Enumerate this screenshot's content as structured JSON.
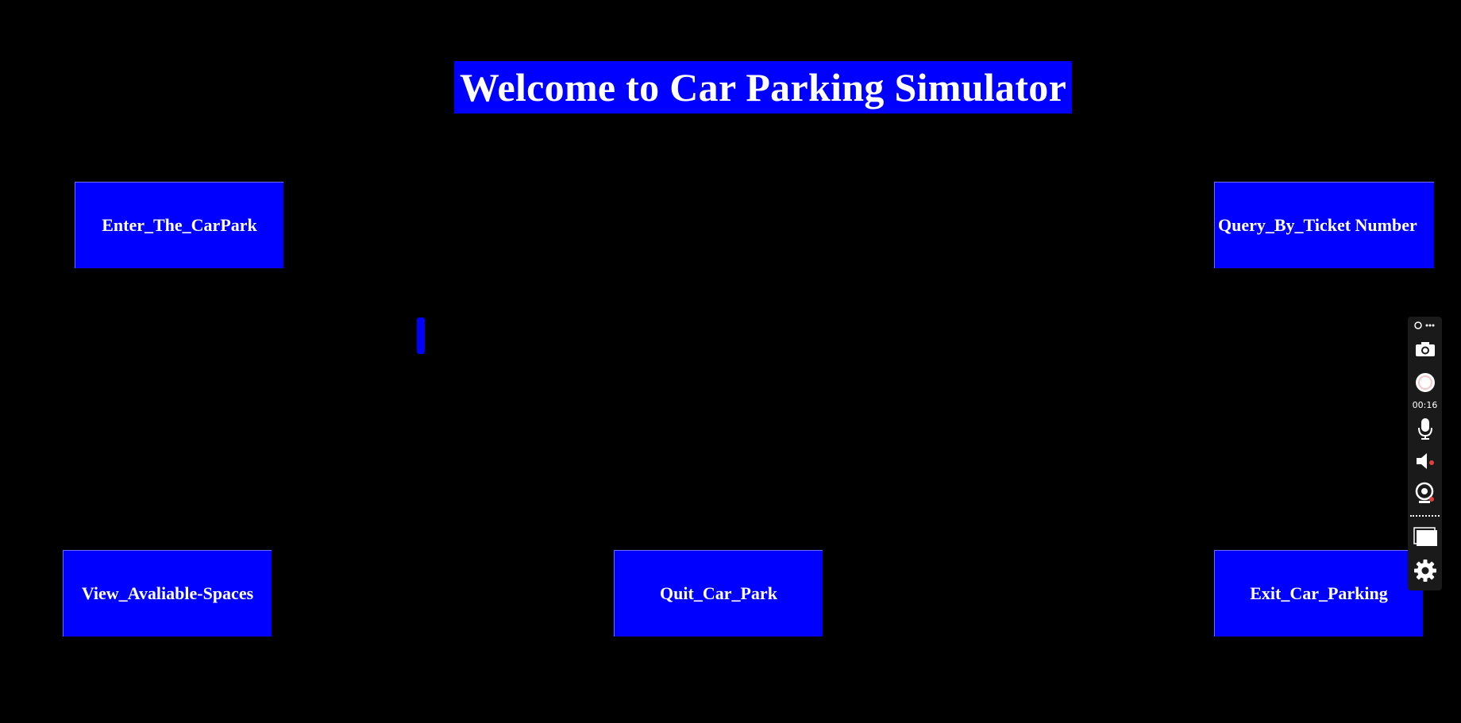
{
  "title": "Welcome to Car Parking Simulator",
  "buttons": {
    "enter": "Enter_The_CarPark",
    "query": "Query_By_Ticket Number",
    "view": "View_Avaliable-Spaces",
    "quit": "Quit_Car_Park",
    "exit": "Exit_Car_Parking"
  },
  "recorder": {
    "elapsed": "00:16",
    "icons": [
      "link-more-icon",
      "camera-icon",
      "record-icon",
      "microphone-icon",
      "speaker-muted-icon",
      "webcam-off-icon",
      "window-icon",
      "gear-icon"
    ]
  },
  "colors": {
    "background": "#000000",
    "accent": "#0000ff",
    "text": "#ffffff"
  }
}
